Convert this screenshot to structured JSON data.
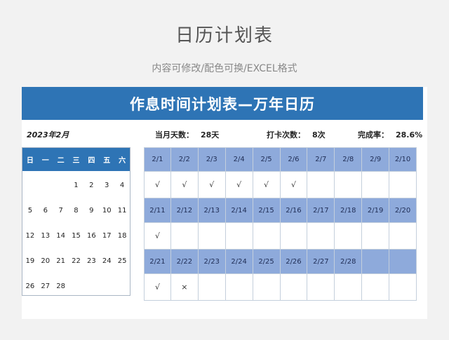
{
  "header": {
    "title": "日历计划表",
    "subtitle": "内容可修改/配色可换/EXCEL格式"
  },
  "sheet": {
    "banner": "作息时间计划表—万年日历",
    "month": "2023年2月",
    "days_label": "当月天数：",
    "days_value": "28天",
    "checkin_label": "打卡次数：",
    "checkin_value": "8次",
    "rate_label": "完成率：",
    "rate_value": "28.6%"
  },
  "mini_calendar": {
    "weekdays": [
      "日",
      "一",
      "二",
      "三",
      "四",
      "五",
      "六"
    ],
    "weeks": [
      [
        "",
        "",
        "",
        "1",
        "2",
        "3",
        "4"
      ],
      [
        "5",
        "6",
        "7",
        "8",
        "9",
        "10",
        "11"
      ],
      [
        "12",
        "13",
        "14",
        "15",
        "16",
        "17",
        "18"
      ],
      [
        "19",
        "20",
        "21",
        "22",
        "23",
        "24",
        "25"
      ],
      [
        "26",
        "27",
        "28",
        "",
        "",
        "",
        ""
      ]
    ]
  },
  "checkin": {
    "rows": [
      {
        "dates": [
          "2/1",
          "2/2",
          "2/3",
          "2/4",
          "2/5",
          "2/6",
          "2/7",
          "2/8",
          "2/9",
          "2/10"
        ],
        "marks": [
          "√",
          "√",
          "√",
          "√",
          "√",
          "√",
          "",
          "",
          "",
          ""
        ]
      },
      {
        "dates": [
          "2/11",
          "2/12",
          "2/13",
          "2/14",
          "2/15",
          "2/16",
          "2/17",
          "2/18",
          "2/19",
          "2/20"
        ],
        "marks": [
          "√",
          "",
          "",
          "",
          "",
          "",
          "",
          "",
          "",
          ""
        ]
      },
      {
        "dates": [
          "2/21",
          "2/22",
          "2/23",
          "2/24",
          "2/25",
          "2/26",
          "2/27",
          "2/28",
          "",
          ""
        ],
        "marks": [
          "√",
          "×",
          "",
          "",
          "",
          "",
          "",
          "",
          "",
          ""
        ]
      }
    ]
  },
  "colors": {
    "banner": "#2e74b5",
    "date_cell": "#8eaadb",
    "background": "#f2f2f2"
  }
}
